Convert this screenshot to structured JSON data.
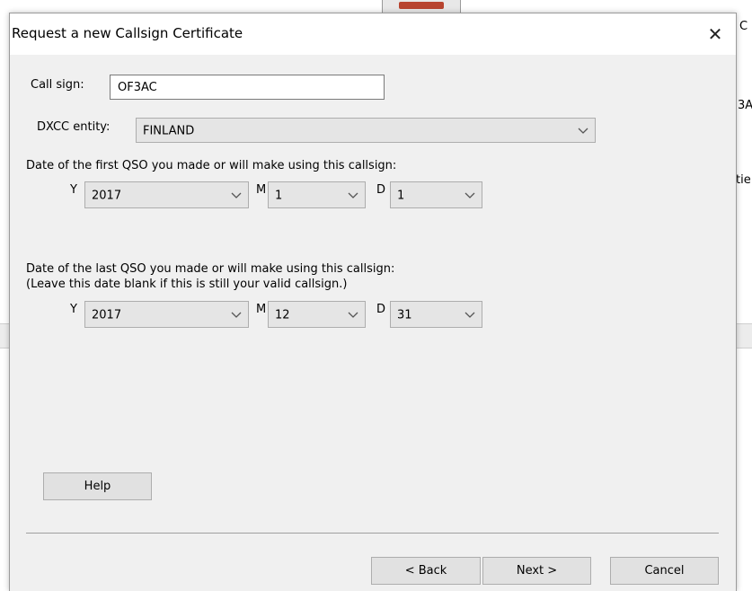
{
  "background": {
    "fragments": [
      "C",
      "3A",
      "tie"
    ]
  },
  "dialog": {
    "title": "Request a new Callsign Certificate",
    "close_symbol": "✕",
    "call_sign": {
      "label": "Call sign:",
      "value": "OF3AC"
    },
    "dxcc": {
      "label": "DXCC entity:",
      "value": "FINLAND"
    },
    "first_qso": {
      "label": "Date of the first QSO you made or will make using this callsign:",
      "y_label": "Y",
      "year": "2017",
      "m_label": "M",
      "month": "1",
      "d_label": "D",
      "day": "1"
    },
    "last_qso": {
      "label": "Date of the last QSO you made or will make using this callsign:",
      "note": "(Leave this date blank if this is still your valid callsign.)",
      "y_label": "Y",
      "year": "2017",
      "m_label": "M",
      "month": "12",
      "d_label": "D",
      "day": "31"
    },
    "buttons": {
      "help": "Help",
      "back": "< Back",
      "next": "Next >",
      "cancel": "Cancel"
    }
  },
  "icons": {
    "dropdown": "chevron-down-icon",
    "close": "close-icon"
  },
  "colors": {
    "dialog_bg": "#f0f0f0",
    "combo_bg": "#e5e5e5",
    "button_bg": "#e1e1e1"
  }
}
